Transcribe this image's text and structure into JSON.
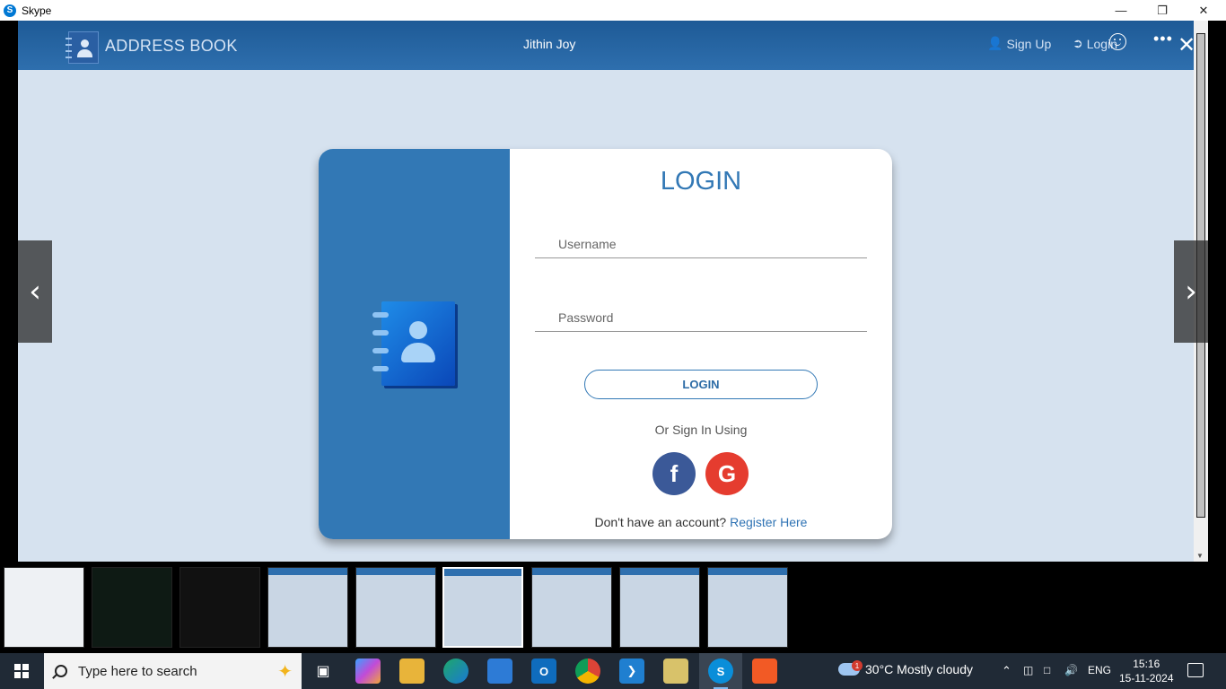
{
  "window": {
    "title": "Skype"
  },
  "app": {
    "brand": "ADDRESS BOOK",
    "user": "Jithin Joy",
    "signup": "Sign Up",
    "login_nav": "Login"
  },
  "login": {
    "title": "LOGIN",
    "username_placeholder": "Username",
    "password_placeholder": "Password",
    "button": "LOGIN",
    "or_text": "Or Sign In Using",
    "facebook": "f",
    "google": "G",
    "no_account": "Don't have an account?",
    "register": "Register Here"
  },
  "viewer": {
    "prev": "‹",
    "next": "›",
    "more": "•••",
    "close": "✕"
  },
  "taskbar": {
    "search_placeholder": "Type here to search",
    "weather": "30°C  Mostly cloudy",
    "weather_badge": "1",
    "language": "ENG",
    "time": "15:16",
    "date": "15-11-2024"
  },
  "colors": {
    "primary": "#3278b5",
    "facebook": "#3b5998",
    "google": "#e53c2f"
  }
}
